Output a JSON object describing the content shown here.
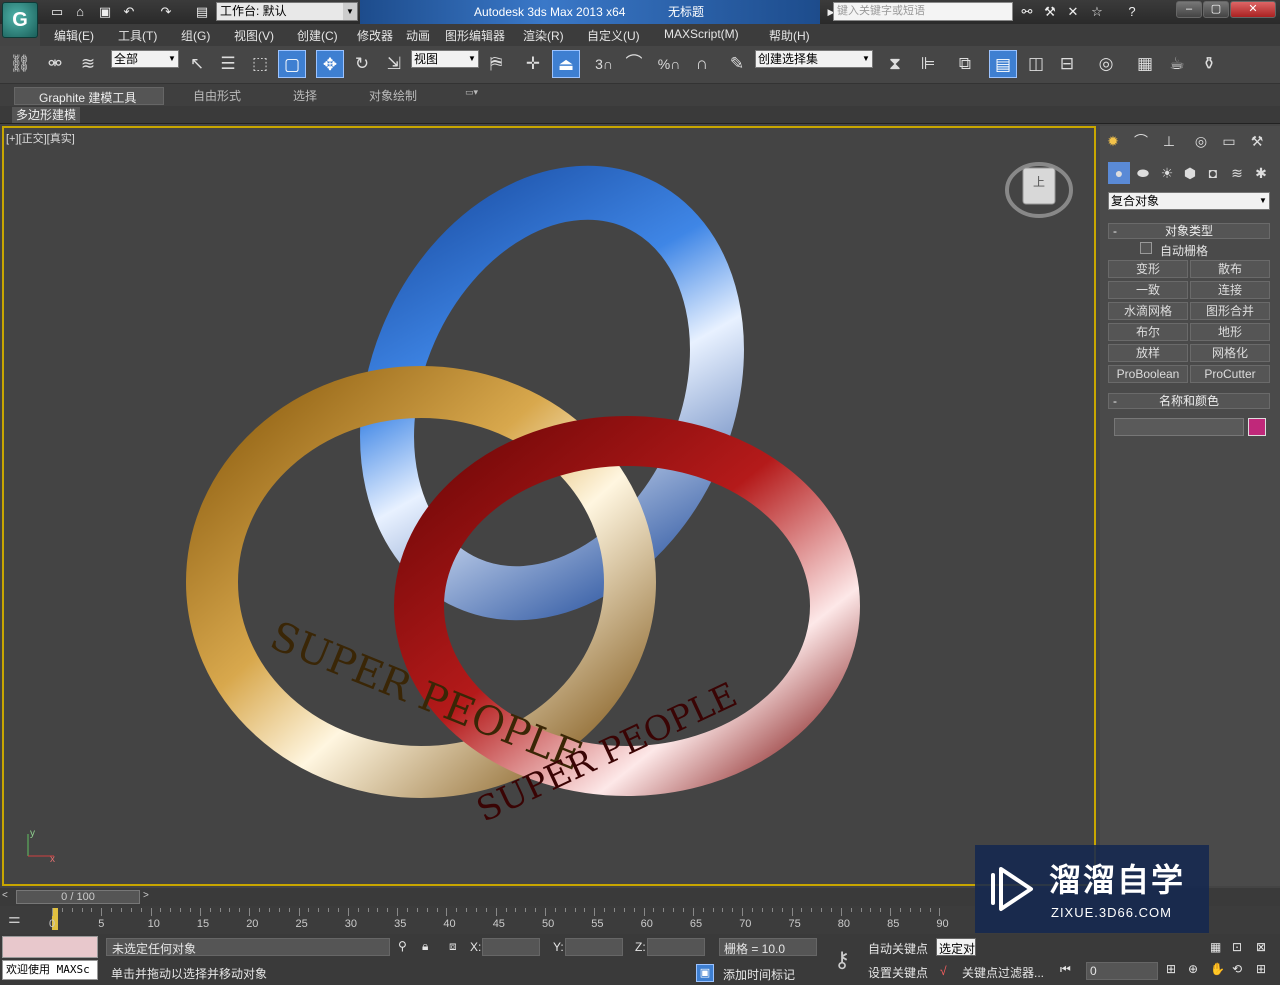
{
  "app": {
    "title": "Autodesk 3ds Max  2013 x64",
    "doc_title": "无标题",
    "workspace_label": "工作台: 默认",
    "search_placeholder": "键入关键字或短语",
    "logo": "G"
  },
  "menu": [
    "编辑(E)",
    "工具(T)",
    "组(G)",
    "视图(V)",
    "创建(C)",
    "修改器",
    "动画",
    "图形编辑器",
    "渲染(R)",
    "自定义(U)",
    "MAXScript(M)",
    "帮助(H)"
  ],
  "toolbar": {
    "selection_filter": "全部",
    "ref_coord": "视图",
    "named_selection": "创建选择集",
    "snap_3": "3",
    "snap_percent": "%"
  },
  "ribbon": {
    "tabs": [
      "Graphite 建模工具",
      "自由形式",
      "选择",
      "对象绘制"
    ],
    "sub_label": "多边形建模"
  },
  "viewport": {
    "label_plus": "[+]",
    "label_view": "[正交]",
    "label_shading": "[真实]",
    "ring_text": "SUPER PEOPLE",
    "ring_colors": {
      "gold": "#a6741c",
      "blue": "#2a67c9",
      "red": "#a11515"
    },
    "axis_y": "y",
    "axis_x": "x",
    "viewcube_face": "上"
  },
  "command_panel": {
    "category": "复合对象",
    "rollout_object_type": "对象类型",
    "auto_grid": "自动栅格",
    "buttons": [
      "变形",
      "散布",
      "一致",
      "连接",
      "水滴网格",
      "图形合并",
      "布尔",
      "地形",
      "放样",
      "网格化",
      "ProBoolean",
      "ProCutter"
    ],
    "rollout_name_color": "名称和颜色",
    "swatch_color": "#c0287a"
  },
  "timeline": {
    "frame_display": "0 / 100",
    "ticks": [
      "0",
      "5",
      "10",
      "15",
      "20",
      "25",
      "30",
      "35",
      "40",
      "45",
      "50",
      "55",
      "60",
      "65",
      "70",
      "75",
      "80",
      "85",
      "90"
    ]
  },
  "status": {
    "welcome": "欢迎使用 MAXSc",
    "selection": "未选定任何对象",
    "prompt": "单击并拖动以选择并移动对象",
    "x_label": "X:",
    "y_label": "Y:",
    "z_label": "Z:",
    "grid": "栅格 = 10.0",
    "auto_key": "自动关键点",
    "set_key": "设置关键点",
    "selected": "选定对",
    "key_filters": "关键点过滤器...",
    "add_time_tag": "添加时间标记",
    "frame": "0"
  },
  "watermark": {
    "title": "溜溜自学",
    "url": "ZIXUE.3D66.COM"
  }
}
